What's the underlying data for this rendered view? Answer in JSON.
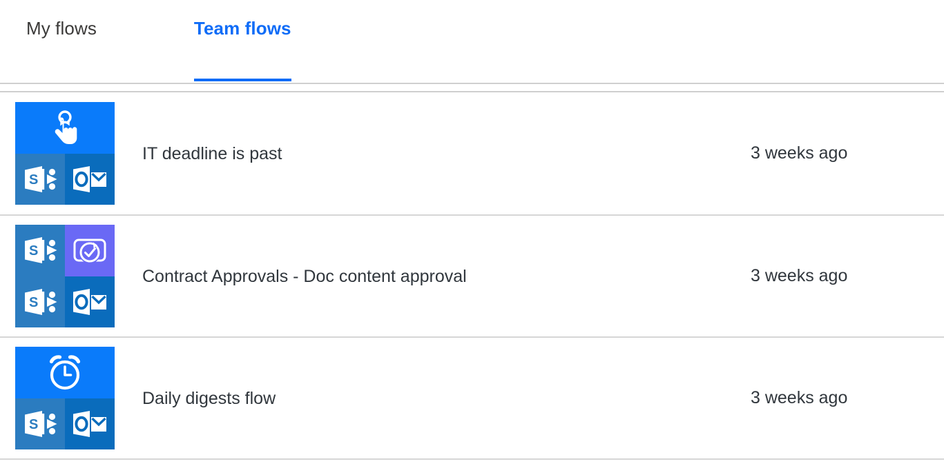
{
  "tabs": [
    {
      "label": "My flows",
      "active": false,
      "name": "tab-my-flows"
    },
    {
      "label": "Team flows",
      "active": true,
      "name": "tab-team-flows"
    }
  ],
  "colors": {
    "accent": "#0f6cf7",
    "trigger_tile": "#0a7bfa",
    "sharepoint_tile": "#2b7cc0",
    "outlook_tile": "#0a6cbc",
    "approvals_tile": "#6a69f5",
    "divider": "#d6d6d6",
    "text": "#31373d"
  },
  "flows": [
    {
      "name": "IT deadline is past",
      "modified": "3 weeks ago",
      "icons": [
        {
          "slot": "wide",
          "kind": "trigger",
          "icon": "manual-tap-trigger-icon"
        },
        {
          "slot": "normal",
          "kind": "sharepoint",
          "icon": "sharepoint-icon"
        },
        {
          "slot": "normal",
          "kind": "outlook",
          "icon": "outlook-icon"
        }
      ]
    },
    {
      "name": "Contract Approvals - Doc content approval",
      "modified": "3 weeks ago",
      "icons": [
        {
          "slot": "normal",
          "kind": "sharepoint",
          "icon": "sharepoint-icon"
        },
        {
          "slot": "normal",
          "kind": "approvals",
          "icon": "approvals-icon"
        },
        {
          "slot": "normal",
          "kind": "sharepoint",
          "icon": "sharepoint-icon"
        },
        {
          "slot": "normal",
          "kind": "outlook",
          "icon": "outlook-icon"
        }
      ]
    },
    {
      "name": "Daily digests flow",
      "modified": "3 weeks ago",
      "icons": [
        {
          "slot": "wide",
          "kind": "trigger",
          "icon": "alarm-clock-recurrence-icon"
        },
        {
          "slot": "normal",
          "kind": "sharepoint",
          "icon": "sharepoint-icon"
        },
        {
          "slot": "normal",
          "kind": "outlook",
          "icon": "outlook-icon"
        }
      ]
    }
  ]
}
